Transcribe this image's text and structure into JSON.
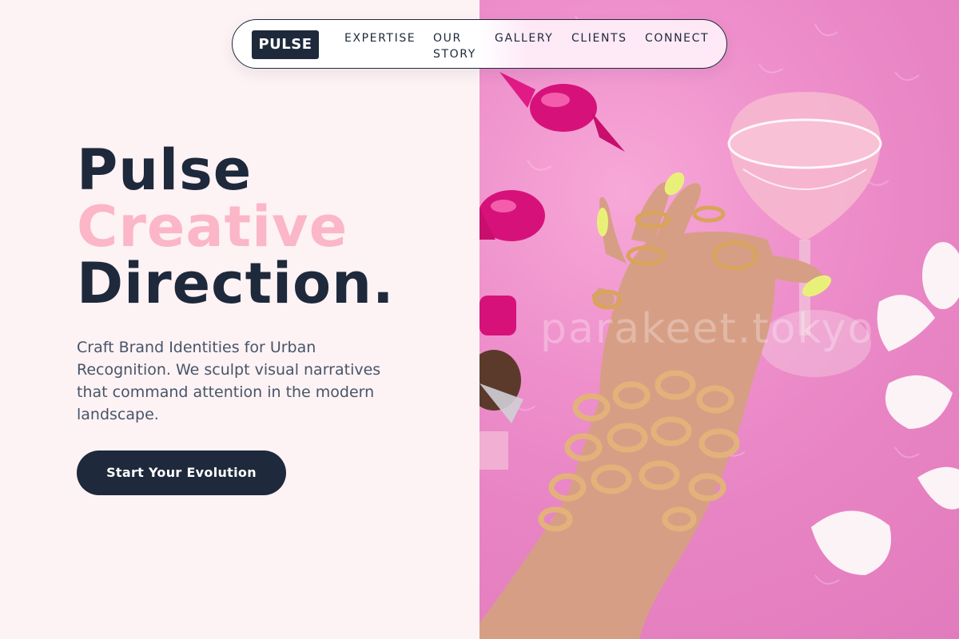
{
  "nav": {
    "logo": "PULSE",
    "items": [
      "EXPERTISE",
      "OUR STORY",
      "GALLERY",
      "CLIENTS",
      "CONNECT"
    ]
  },
  "hero": {
    "title_line1": "Pulse",
    "title_line2": "Creative",
    "title_line3": "Direction.",
    "description": "Craft Brand Identities for Urban Recognition. We sculpt visual narratives that command attention in the modern landscape.",
    "cta_label": "Start Your Evolution"
  },
  "image": {
    "watermark": "parakeet.tokyo",
    "subject_icons": [
      "candy-icon",
      "cocktail-glass-icon",
      "hand-icon",
      "ring-icon",
      "chain-bracelet-icon",
      "petal-icon"
    ]
  },
  "colors": {
    "navy": "#1e293b",
    "pink_accent": "#fbb6c8",
    "background": "#fdf2f4",
    "fur_pink": "#e884c4",
    "magenta_candy": "#d6127a",
    "gold": "#d9a45b",
    "nail_yellow": "#e9f07a"
  }
}
